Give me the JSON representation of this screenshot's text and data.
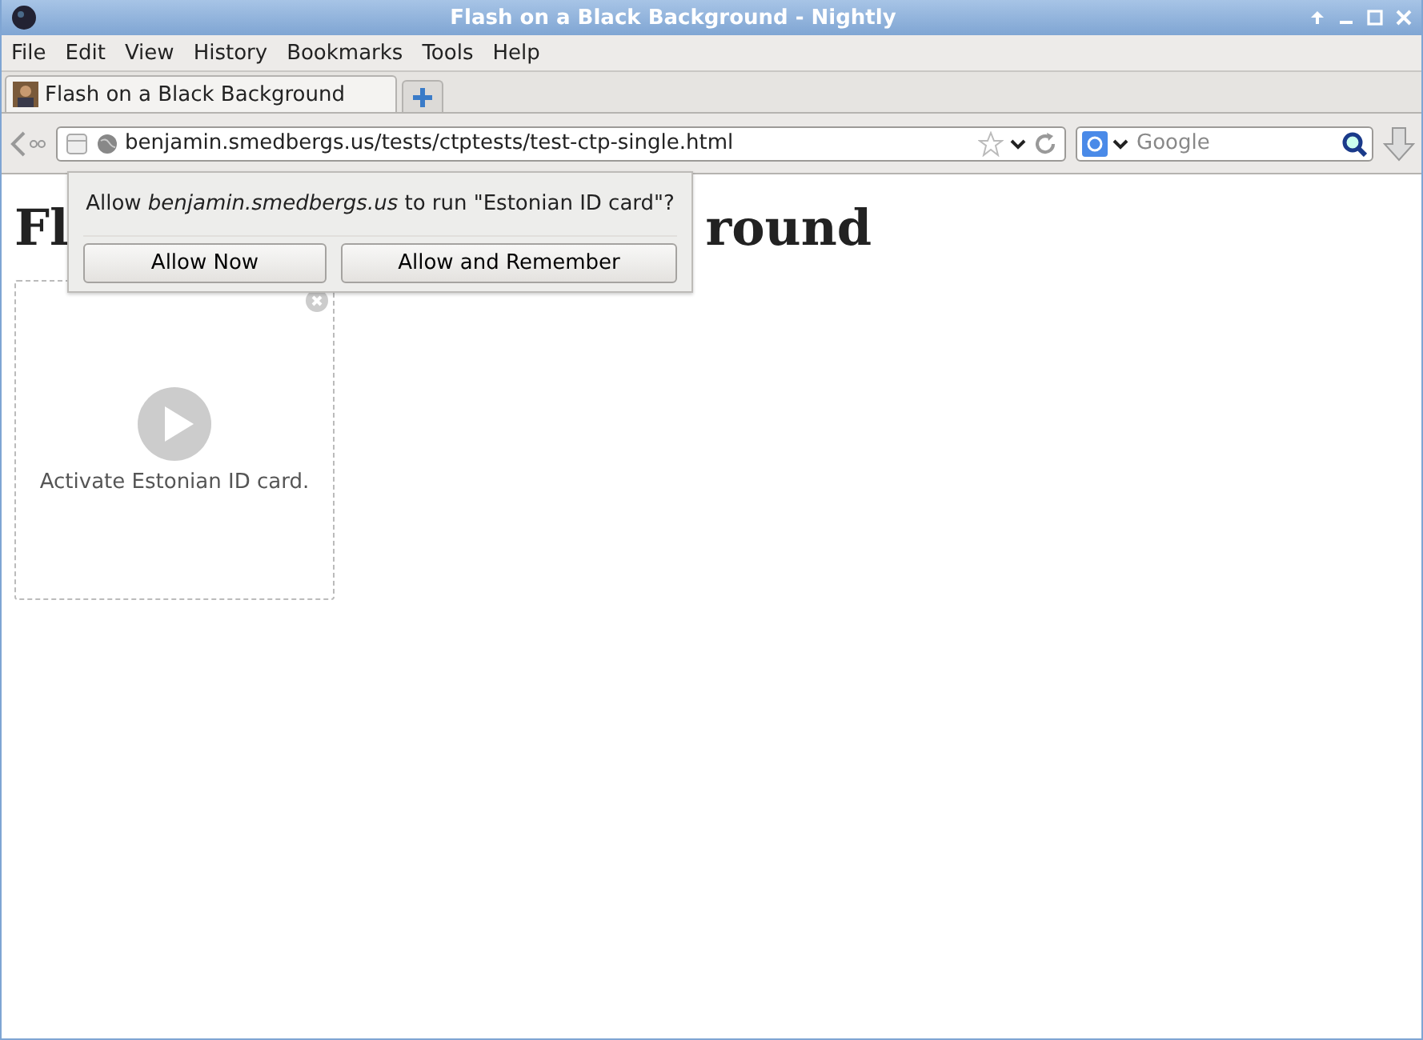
{
  "window": {
    "title": "Flash on a Black Background - Nightly"
  },
  "menu": [
    "File",
    "Edit",
    "View",
    "History",
    "Bookmarks",
    "Tools",
    "Help"
  ],
  "tabs": [
    {
      "label": "Flash on a Black Background",
      "selected": true
    }
  ],
  "address": {
    "value": "benjamin.smedbergs.us/tests/ctptests/test-ctp-single.html"
  },
  "search": {
    "placeholder": "Google"
  },
  "heading": {
    "visible_start": "Fl",
    "visible_end": "round"
  },
  "popup": {
    "message": "Allow *benjamin.smedbergs.us* to run \"Estonian ID card\"?",
    "buttons": [
      "Allow Now",
      "Allow and Remember"
    ]
  },
  "plugin": {
    "label": "Activate Estonian ID card."
  }
}
